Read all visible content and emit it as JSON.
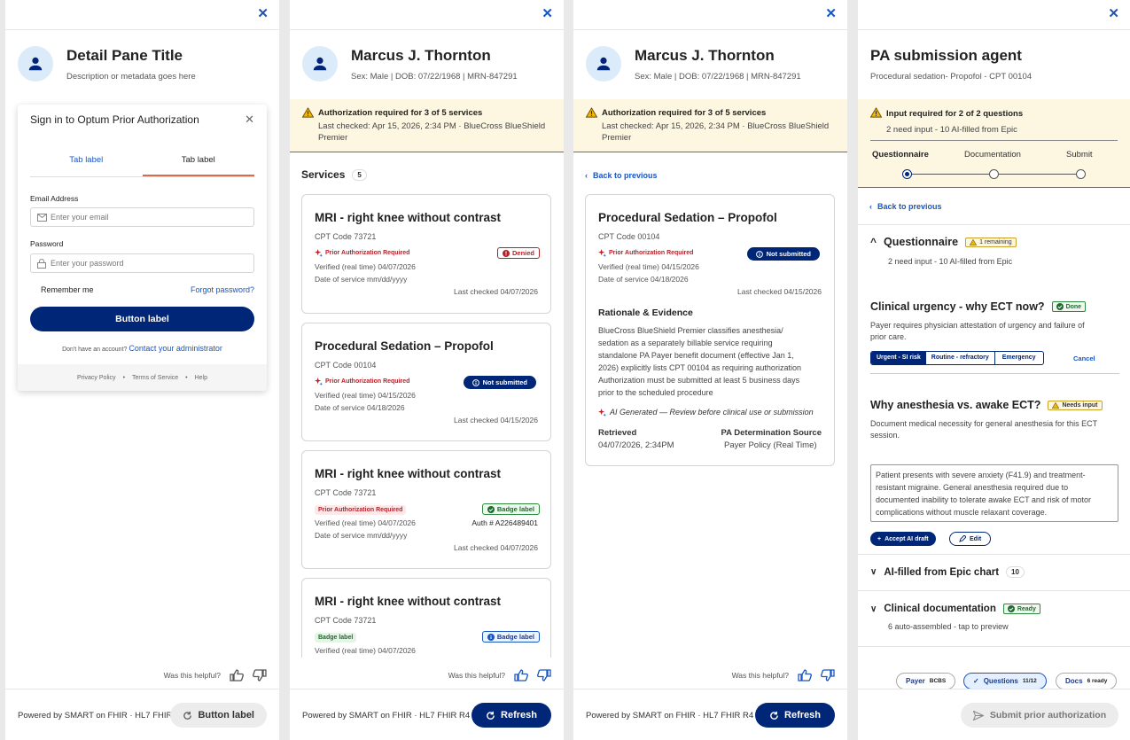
{
  "common": {
    "helpful": "Was this helpful?",
    "powered": "Powered by SMART on FHIR · HL7 FHIR R4",
    "powered_cut": "Powered by SMART on FHIR · HL7 FHIR I",
    "refresh": "Refresh",
    "last_checked": "Last checked: Apr 15, 2026, 2:34 PM · BlueCross BlueShield",
    "premier": "Premier",
    "alert_title": "Authorization required for 3 of 5 services",
    "back": "Back to previous"
  },
  "pane1": {
    "title": "Detail Pane Title",
    "desc": "Description or metadata goes here",
    "footer_button": "Button label",
    "modal": {
      "title": "Sign in to Optum Prior Authorization",
      "tabs": [
        "Tab label",
        "Tab label"
      ],
      "email_label": "Email Address",
      "email_placeholder": "Enter your email",
      "password_label": "Password",
      "password_placeholder": "Enter your password",
      "remember": "Remember me",
      "forgot": "Forgot password?",
      "button": "Button label",
      "no_account": "Don't have an account?",
      "contact": "Contact your administrator",
      "links": [
        "Privacy Policy",
        "Terms of Service",
        "Help"
      ]
    }
  },
  "patient": {
    "name": "Marcus J. Thornton",
    "meta": "Sex: Male | DOB: 07/22/1968 | MRN-847291"
  },
  "pane2": {
    "services_label": "Services",
    "services_count": "5",
    "cards": [
      {
        "title": "MRI - right knee without contrast",
        "cpt": "CPT Code 73721",
        "pill": "Prior Authorization Required",
        "verified": "Verified (real time) 04/07/2026",
        "dos": "Date of service  mm/dd/yyyy",
        "badge": "Denied",
        "last": "Last checked 04/07/2026"
      },
      {
        "title": "Procedural Sedation – Propofol",
        "cpt": "CPT Code 00104",
        "pill": "Prior Authorization Required",
        "verified": "Verified (real time) 04/15/2026",
        "dos": "Date of service  04/18/2026",
        "badge": "Not submitted",
        "last": "Last checked 04/15/2026"
      },
      {
        "title": "MRI - right knee without contrast",
        "cpt": "CPT Code 73721",
        "pill": "Prior Authorization Required",
        "verified": "Verified (real time) 04/07/2026",
        "dos": "Date of service  mm/dd/yyyy",
        "badge": "Badge label",
        "auth": "Auth # A226489401",
        "last": "Last checked 04/07/2026"
      },
      {
        "title": "MRI - right knee without contrast",
        "cpt": "CPT Code 73721",
        "pill": "Badge label",
        "verified": "Verified (real time) 04/07/2026",
        "badge": "Badge label"
      }
    ]
  },
  "pane3": {
    "title": "Procedural Sedation – Propofol",
    "cpt": "CPT Code 00104",
    "pill": "Prior Authorization Required",
    "verified": "Verified (real time) 04/15/2026",
    "dos": "Date of service  04/18/2026",
    "badge": "Not submitted",
    "last": "Last checked 04/15/2026",
    "rationale_title": "Rationale & Evidence",
    "rationale_lines": [
      "BlueCross BlueShield Premier classifies anesthesia/",
      "sedation as a separately billable service requiring",
      "standalone PA Payer benefit document (effective Jan 1,",
      "2026) explicitly lists CPT 00104 as requiring authorization",
      "Authorization must be submitted at least 5 business days",
      "prior to the scheduled procedure"
    ],
    "ai_note": "AI Generated — Review before clinical use or submission",
    "retrieved_label": "Retrieved",
    "retrieved_value": "04/07/2026, 2:34PM",
    "source_label": "PA Determination Source",
    "source_value": "Payer Policy (Real Time)"
  },
  "pane4": {
    "title": "PA submission agent",
    "sub": "Procedural sedation- Propofol - CPT 00104",
    "alert_title": "Input required for 2 of 2 questions",
    "alert_sub": "2 need input - 10 AI-filled from Epic",
    "steps": [
      "Questionnaire",
      "Documentation",
      "Submit"
    ],
    "q_section": "Questionnaire",
    "q_remaining": "1 remaining",
    "q_section_sub": "2 need input - 10 AI-filled from Epic",
    "q1_title": "Clinical urgency - why ECT now?",
    "q1_badge": "Done",
    "q1_desc": "Payer requires physician attestation of urgency and failure of prior care.",
    "q1_options": [
      "Urgent - SI risk",
      "Routine - refractory",
      "Emergency"
    ],
    "q1_cancel": "Cancel",
    "q2_title": "Why anesthesia vs. awake ECT?",
    "q2_badge": "Needs input",
    "q2_desc": "Document medical necessity for general anesthesia for this ECT session.",
    "q2_answer": "Patient presents with severe anxiety (F41.9) and treatment-resistant migraine. General anesthesia required due to documented inability to tolerate awake ECT and risk of motor complications without muscle relaxant coverage.",
    "accept": "Accept AI draft",
    "edit": "Edit",
    "ai_filled": "AI-filled from Epic chart",
    "ai_filled_count": "10",
    "clin_doc": "Clinical documentation",
    "clin_badge": "Ready",
    "clin_sub": "6 auto-assembled - tap to preview",
    "chips": [
      {
        "label": "Payer",
        "value": "BCBS"
      },
      {
        "label": "Questions",
        "value": "11/12"
      },
      {
        "label": "Docs",
        "value": "6 ready"
      }
    ],
    "submit": "Submit prior authorization"
  },
  "colors": {
    "brand": "#002677",
    "link": "#1a56c2",
    "alert_bg": "#fdf6e0",
    "danger": "#b4232a",
    "success": "#1f6a2e"
  }
}
